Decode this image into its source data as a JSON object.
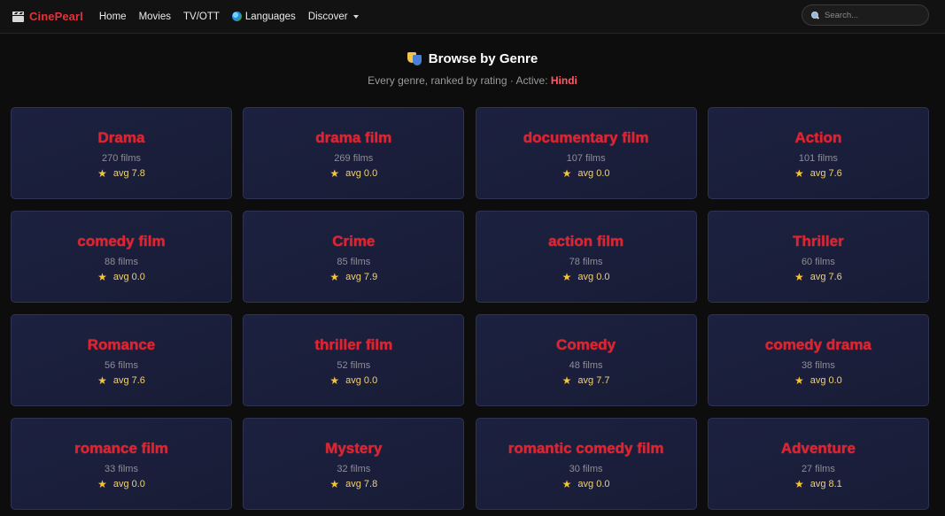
{
  "navbar": {
    "brand": "CinePearl",
    "links": [
      "Home",
      "Movies",
      "TV/OTT",
      "Languages",
      "Discover"
    ],
    "search_placeholder": "Search..."
  },
  "header": {
    "title": "Browse by Genre",
    "subtitle_prefix": "Every genre, ranked by rating · Active: ",
    "active_language": "Hindi"
  },
  "genres": [
    {
      "name": "Drama",
      "count": "270 films",
      "rating": "avg 7.8"
    },
    {
      "name": "drama film",
      "count": "269 films",
      "rating": "avg 0.0"
    },
    {
      "name": "documentary film",
      "count": "107 films",
      "rating": "avg 0.0"
    },
    {
      "name": "Action",
      "count": "101 films",
      "rating": "avg 7.6"
    },
    {
      "name": "comedy film",
      "count": "88 films",
      "rating": "avg 0.0"
    },
    {
      "name": "Crime",
      "count": "85 films",
      "rating": "avg 7.9"
    },
    {
      "name": "action film",
      "count": "78 films",
      "rating": "avg 0.0"
    },
    {
      "name": "Thriller",
      "count": "60 films",
      "rating": "avg 7.6"
    },
    {
      "name": "Romance",
      "count": "56 films",
      "rating": "avg 7.6"
    },
    {
      "name": "thriller film",
      "count": "52 films",
      "rating": "avg 0.0"
    },
    {
      "name": "Comedy",
      "count": "48 films",
      "rating": "avg 7.7"
    },
    {
      "name": "comedy drama",
      "count": "38 films",
      "rating": "avg 0.0"
    },
    {
      "name": "romance film",
      "count": "33 films",
      "rating": "avg 0.0"
    },
    {
      "name": "Mystery",
      "count": "32 films",
      "rating": "avg 7.8"
    },
    {
      "name": "romantic comedy film",
      "count": "30 films",
      "rating": "avg 0.0"
    },
    {
      "name": "Adventure",
      "count": "27 films",
      "rating": "avg 8.1"
    }
  ],
  "colors": {
    "accent": "#e0232f",
    "star": "#f7c531",
    "card_bg": "#1c2140",
    "page_bg": "#0d0d0d"
  }
}
